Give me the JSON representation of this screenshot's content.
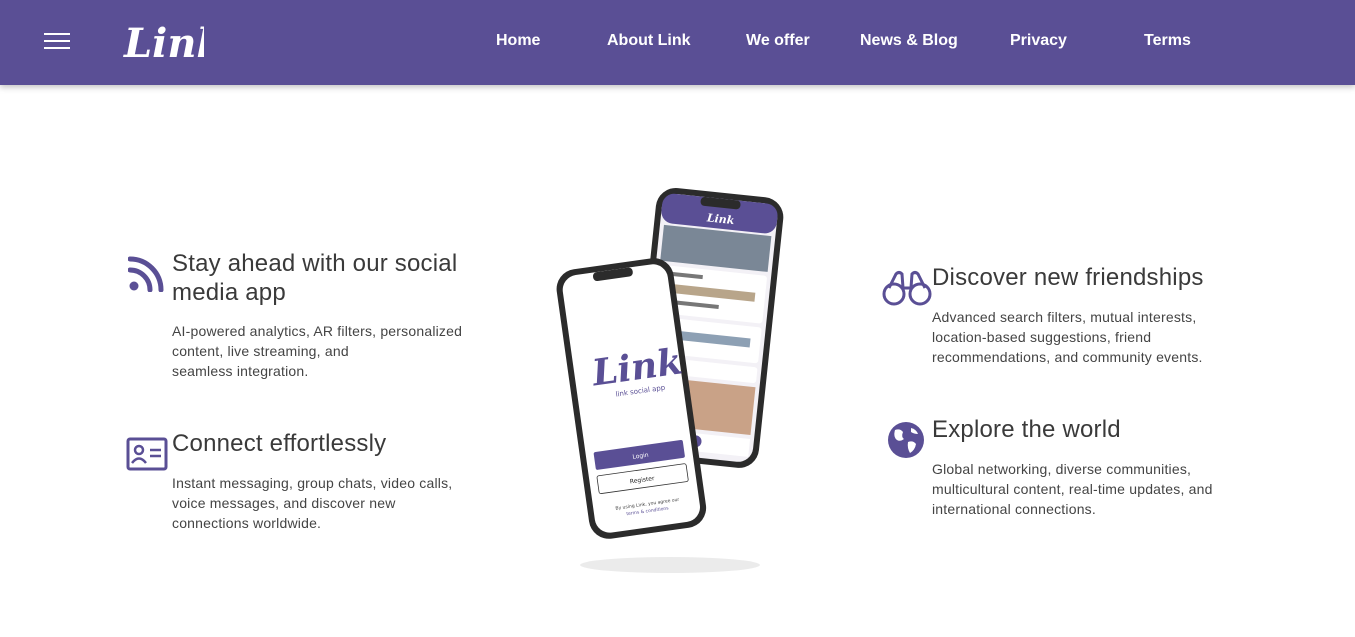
{
  "header": {
    "logo_text": "Link",
    "nav": [
      {
        "label": "Home"
      },
      {
        "label": "About Link"
      },
      {
        "label": "We offer"
      },
      {
        "label": "News & Blog"
      },
      {
        "label": "Privacy"
      },
      {
        "label": "Terms"
      }
    ]
  },
  "features": {
    "left_top": {
      "icon": "rss-icon",
      "title_line1": "Stay ahead with our social",
      "title_line2": "media app",
      "text_line1": "AI-powered analytics, AR filters, personalized",
      "text_line2": "content, live streaming, and",
      "text_line3": "seamless integration."
    },
    "left_bottom": {
      "icon": "id-card-icon",
      "title": "Connect effortlessly",
      "text_line1": "Instant messaging, group chats, video calls,",
      "text_line2": "voice messages, and discover new",
      "text_line3": "connections worldwide."
    },
    "right_top": {
      "icon": "binoculars-icon",
      "title": "Discover new friendships",
      "text_line1": "Advanced search filters, mutual interests,",
      "text_line2": "location-based suggestions, friend",
      "text_line3": "recommendations, and community events."
    },
    "right_bottom": {
      "icon": "globe-icon",
      "title": "Explore the world",
      "text_line1": "Global networking, diverse communities,",
      "text_line2": "multicultural content, real-time updates, and",
      "text_line3": "international connections."
    }
  },
  "phone_mockup": {
    "front_logo": "Link",
    "front_subtitle": "link social app",
    "login_label": "Login",
    "register_label": "Register",
    "terms_line1": "By using Link, you agree our",
    "terms_line2": "terms & conditions",
    "back_header_logo": "Link"
  },
  "colors": {
    "brand": "#5a4f95",
    "text": "#3a3a3a"
  }
}
